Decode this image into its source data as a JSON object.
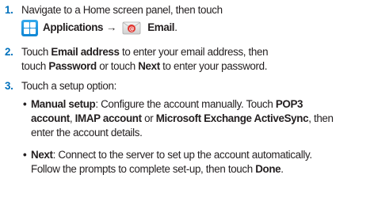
{
  "steps": [
    {
      "number": "1.",
      "line1": "Navigate to a Home screen panel, then touch",
      "apps_label": "Applications",
      "arrow": "→",
      "email_label": "Email",
      "period": "."
    },
    {
      "number": "2.",
      "t1": "Touch ",
      "email_address": "Email address",
      "t2": " to enter your email address, then",
      "t3": "touch ",
      "password": "Password",
      "t4": " or touch ",
      "next": "Next",
      "t5": " to enter your password."
    },
    {
      "number": "3.",
      "intro": "Touch a setup option:",
      "options": [
        {
          "bullet": "•",
          "name": "Manual setup",
          "l1a": ": Configure the account manually. Touch ",
          "pop3": "POP3",
          "imap_prefix": "account",
          "c1": ", ",
          "imap": "IMAP account",
          "c2": " or ",
          "exchange": "Microsoft Exchange ActiveSync",
          "c3": ", then",
          "l3": "enter the account details."
        },
        {
          "bullet": "•",
          "name": "Next",
          "l1": ": Connect to the server to set up the account automatically.",
          "l2a": "Follow the prompts to complete set-up, then touch ",
          "done": "Done",
          "l2b": "."
        }
      ]
    }
  ],
  "icons": {
    "applications": "applications-grid-icon",
    "email": "email-envelope-icon"
  },
  "colors": {
    "step_number": "#0071bc",
    "text": "#231f20",
    "apps_icon": "#1a8fdc",
    "email_badge": "#e0312b"
  }
}
